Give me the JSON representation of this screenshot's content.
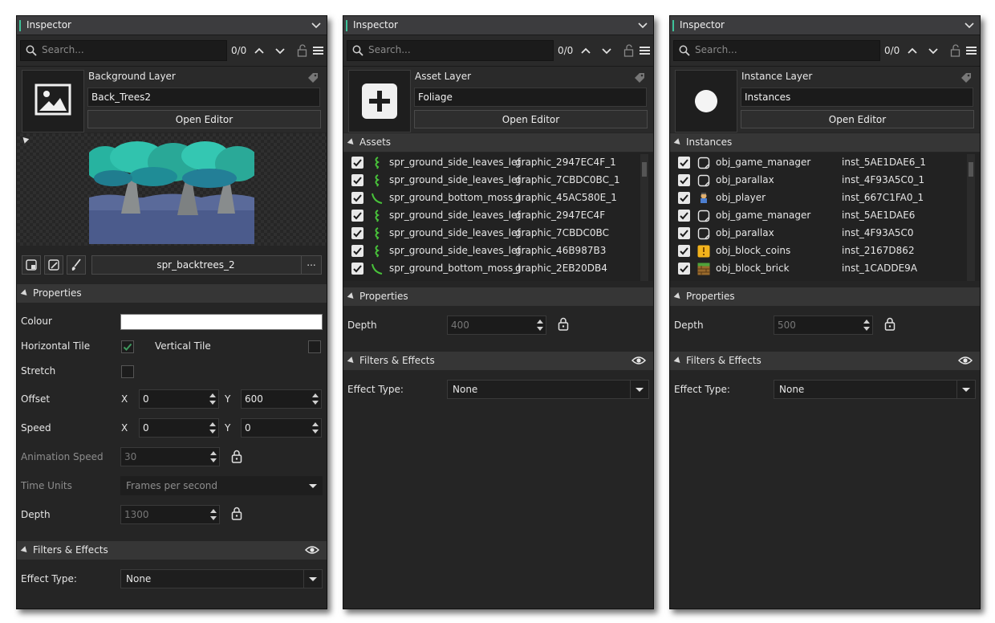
{
  "panels": [
    {
      "title": "Inspector",
      "search_placeholder": "Search...",
      "match_count": "0/0",
      "layer_type": "Background Layer",
      "layer_name": "Back_Trees2",
      "open_editor": "Open Editor",
      "sprite_name": "spr_backtrees_2",
      "sprite_more": "...",
      "properties_label": "Properties",
      "colour_label": "Colour",
      "colour_value": "#ffffff",
      "horizontal_tile_label": "Horizontal Tile",
      "horizontal_tile_checked": true,
      "vertical_tile_label": "Vertical Tile",
      "vertical_tile_checked": false,
      "stretch_label": "Stretch",
      "stretch_checked": false,
      "offset_label": "Offset",
      "offset_x_label": "X",
      "offset_x": "0",
      "offset_y_label": "Y",
      "offset_y": "600",
      "speed_label": "Speed",
      "speed_x_label": "X",
      "speed_x": "0",
      "speed_y_label": "Y",
      "speed_y": "0",
      "animation_speed_label": "Animation Speed",
      "animation_speed": "30",
      "time_units_label": "Time Units",
      "time_units": "Frames per second",
      "depth_label": "Depth",
      "depth": "1300",
      "filters_label": "Filters & Effects",
      "effect_type_label": "Effect Type:",
      "effect_type": "None"
    },
    {
      "title": "Inspector",
      "search_placeholder": "Search...",
      "match_count": "0/0",
      "layer_type": "Asset Layer",
      "layer_name": "Foliage",
      "open_editor": "Open Editor",
      "list_section_label": "Assets",
      "list": [
        {
          "icon": "green-vine-icon",
          "name": "spr_ground_side_leaves_lef",
          "id": "graphic_2947EC4F_1"
        },
        {
          "icon": "green-vine-icon",
          "name": "spr_ground_side_leaves_lef",
          "id": "graphic_7CBDC0BC_1"
        },
        {
          "icon": "green-moss-icon",
          "name": "spr_ground_bottom_moss_l",
          "id": "graphic_45AC580E_1"
        },
        {
          "icon": "green-vine-icon",
          "name": "spr_ground_side_leaves_lef",
          "id": "graphic_2947EC4F"
        },
        {
          "icon": "green-vine-icon",
          "name": "spr_ground_side_leaves_lef",
          "id": "graphic_7CBDC0BC"
        },
        {
          "icon": "green-vine-icon",
          "name": "spr_ground_side_leaves_lef",
          "id": "graphic_46B987B3"
        },
        {
          "icon": "green-moss-icon",
          "name": "spr_ground_bottom_moss_l",
          "id": "graphic_2EB20DB4"
        }
      ],
      "properties_label": "Properties",
      "depth_label": "Depth",
      "depth": "400",
      "filters_label": "Filters & Effects",
      "effect_type_label": "Effect Type:",
      "effect_type": "None"
    },
    {
      "title": "Inspector",
      "search_placeholder": "Search...",
      "match_count": "0/0",
      "layer_type": "Instance Layer",
      "layer_name": "Instances",
      "open_editor": "Open Editor",
      "list_section_label": "Instances",
      "list": [
        {
          "icon": "object-icon",
          "name": "obj_game_manager",
          "id": "inst_5AE1DAE6_1"
        },
        {
          "icon": "object-icon",
          "name": "obj_parallax",
          "id": "inst_4F93A5C0_1"
        },
        {
          "icon": "player-sprite-icon",
          "name": "obj_player",
          "id": "inst_667C1FA0_1"
        },
        {
          "icon": "object-icon",
          "name": "obj_game_manager",
          "id": "inst_5AE1DAE6"
        },
        {
          "icon": "object-icon",
          "name": "obj_parallax",
          "id": "inst_4F93A5C0"
        },
        {
          "icon": "coin-block-icon",
          "name": "obj_block_coins",
          "id": "inst_2167D862"
        },
        {
          "icon": "brick-block-icon",
          "name": "obj_block_brick",
          "id": "inst_1CADDE9A"
        }
      ],
      "properties_label": "Properties",
      "depth_label": "Depth",
      "depth": "500",
      "filters_label": "Filters & Effects",
      "effect_type_label": "Effect Type:",
      "effect_type": "None"
    }
  ],
  "colors": {
    "panel_bg": "#252525",
    "accent": "#3ec39a",
    "check_green": "#3f8f5a",
    "field_bg": "#1b1b1b"
  }
}
